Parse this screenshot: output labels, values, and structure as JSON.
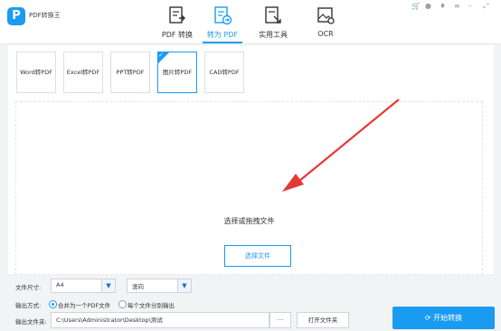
{
  "app": {
    "name": "PDF转换王",
    "logo_letter": "P"
  },
  "nav": {
    "tabs": [
      {
        "label": "PDF 转换",
        "icon": "document-edit-icon"
      },
      {
        "label": "转为 PDF",
        "icon": "document-arrow-icon",
        "active": true
      },
      {
        "label": "实用工具",
        "icon": "document-tools-icon"
      },
      {
        "label": "OCR",
        "icon": "image-scan-icon"
      }
    ]
  },
  "window_controls": [
    "cart-icon",
    "user-icon",
    "bell-icon",
    "menu-icon",
    "minimize-icon",
    "maximize-icon"
  ],
  "subtabs": [
    "Word转PDF",
    "Excel转PDF",
    "PPT转PDF",
    "图片转PDF",
    "CAD转PDF"
  ],
  "dropzone": {
    "hint": "选择或拖拽文件",
    "button": "选择文件"
  },
  "options": {
    "size_label": "文件尺寸:",
    "size_value": "A4",
    "orientation_value": "竖向",
    "output_mode_label": "输出方式:",
    "output_mode_options": [
      "合并为一个PDF文件",
      "每个文件分别输出"
    ],
    "output_folder_label": "输出文件夹:",
    "output_path": "C:\\Users\\Administrator\\Desktop\\测试",
    "browse_label": "...",
    "open_folder_label": "打开文件夹"
  },
  "start_button": "开始转换",
  "colors": {
    "accent": "#1a9bf2",
    "arrow": "#e53935"
  }
}
